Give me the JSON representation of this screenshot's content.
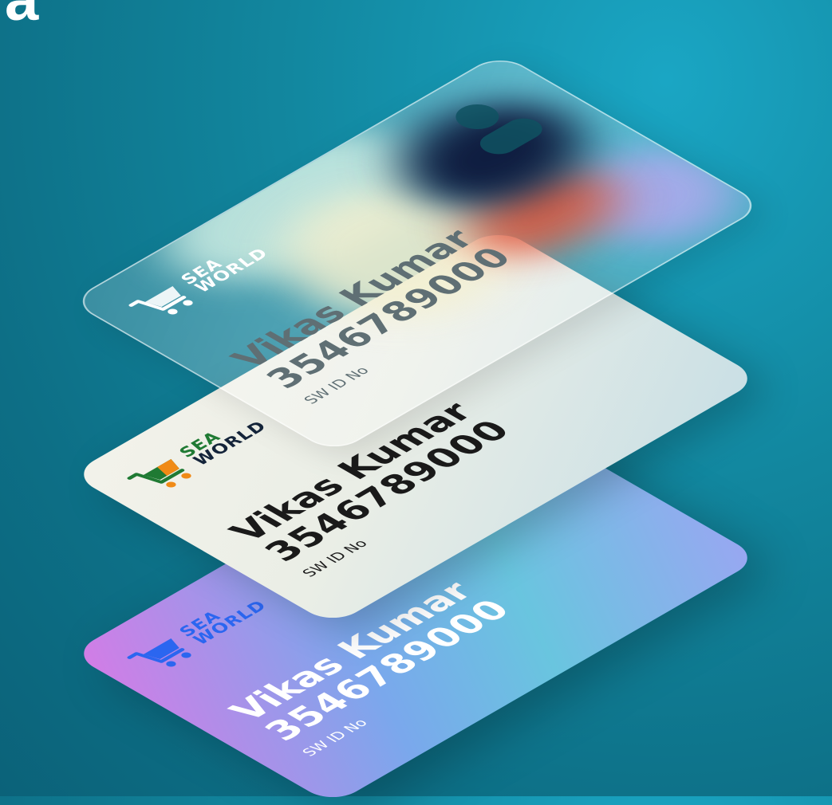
{
  "corner_letter": "a",
  "colors": {
    "background": "#0d6f86",
    "bottom_card_gradient": [
      "#d57be6",
      "#7aa8ec",
      "#69c5df",
      "#9aa6f2"
    ],
    "middle_card": "#f3f2ea",
    "top_card": "frosted-glass",
    "sea_world_blue": "#2b66f0",
    "sea_world_green": "#1f7a33",
    "sea_world_orange": "#f08a16"
  },
  "cards": [
    {
      "layer": "top",
      "logo": {
        "icon": "shopping-cart-icon",
        "line1": "SEA",
        "line2": "WORLD"
      },
      "holder_name": "Vikas Kumar",
      "holder_id": "3546789000",
      "id_label": "SW ID No",
      "avatar_icon": "user-avatar-icon"
    },
    {
      "layer": "middle",
      "logo": {
        "icon": "shopping-cart-icon",
        "line1": "SEA",
        "line2": "WORLD"
      },
      "holder_name": "Vikas Kumar",
      "holder_id": "3546789000",
      "id_label": "SW ID No"
    },
    {
      "layer": "bottom",
      "logo": {
        "icon": "shopping-cart-icon",
        "line1": "SEA",
        "line2": "WORLD"
      },
      "holder_name": "Vikas Kumar",
      "holder_id": "3546789000",
      "id_label": "SW ID No"
    }
  ]
}
